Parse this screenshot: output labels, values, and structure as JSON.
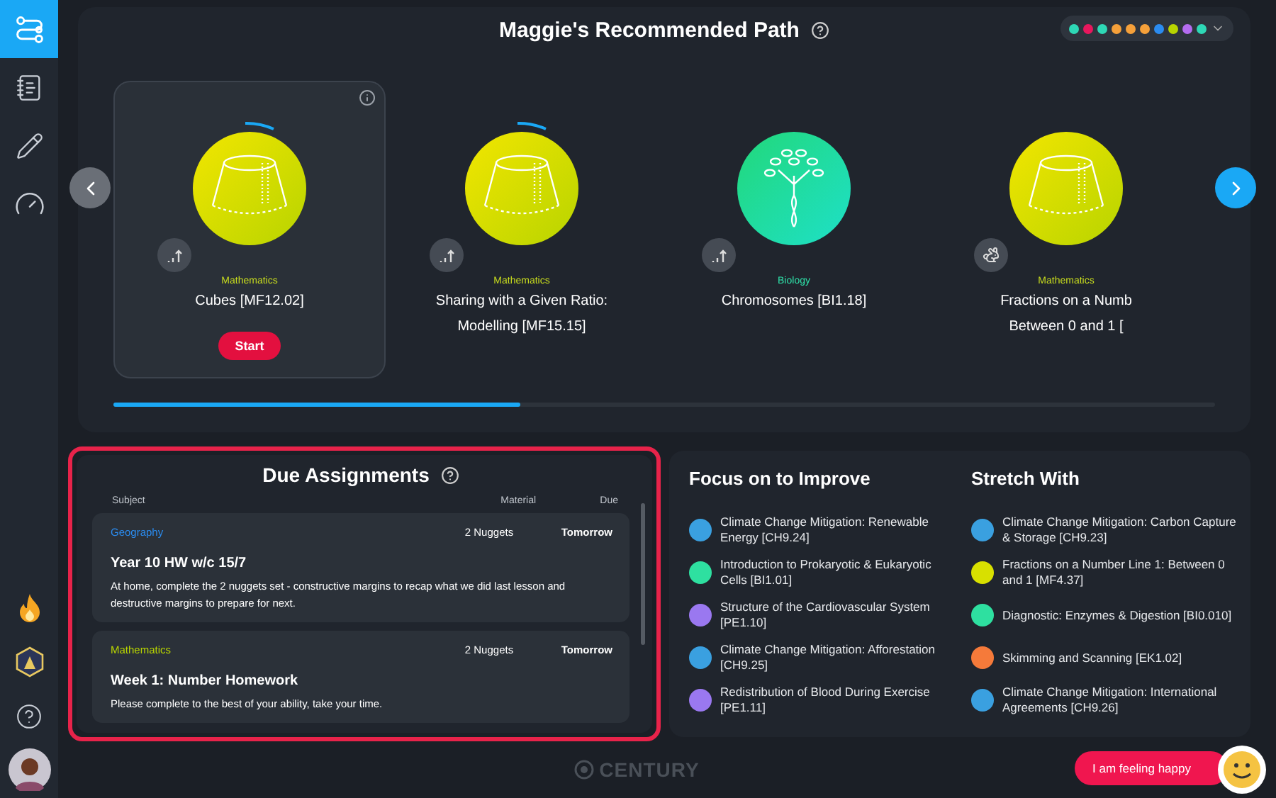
{
  "sidebar": {
    "nav": [
      {
        "kind": "path",
        "selected": true
      },
      {
        "kind": "list",
        "selected": false
      },
      {
        "kind": "pencil",
        "selected": false
      },
      {
        "kind": "gauge",
        "selected": false
      }
    ],
    "bottom": [
      {
        "kind": "flame"
      },
      {
        "kind": "badge"
      },
      {
        "kind": "help"
      },
      {
        "kind": "avatar"
      }
    ]
  },
  "path": {
    "title": "Maggie's Recommended Path",
    "filter_dots": [
      {
        "color": "#2ed8b6"
      },
      {
        "color": "#e8175d"
      },
      {
        "color": "#2ed8b6"
      },
      {
        "color": "#f5a03a"
      },
      {
        "color": "#f5a03a"
      },
      {
        "color": "#f5a03a"
      },
      {
        "color": "#2b8cf0"
      },
      {
        "color": "#b8d400"
      },
      {
        "color": "#b46cf0"
      },
      {
        "color": "#2ed8b6"
      }
    ],
    "cards": [
      {
        "subject": "Mathematics",
        "color": "#c8dc1e",
        "thumbnail": {
          "kind": "cone"
        },
        "badge": {
          "kind": "graph"
        },
        "title_lines": [
          "Cubes [MF12.02]"
        ],
        "started": true,
        "selected": true,
        "action": "Start"
      },
      {
        "subject": "Mathematics",
        "color": "#c8dc1e",
        "thumbnail": {
          "kind": "cone"
        },
        "badge": {
          "kind": "graph"
        },
        "title_lines": [
          "Sharing with a Given Ratio:",
          "Modelling [MF15.15]"
        ],
        "started": true,
        "selected": false
      },
      {
        "subject": "Biology",
        "color": "#2ee0a8",
        "thumbnail": {
          "kind": "tree"
        },
        "badge": {
          "kind": "graph"
        },
        "title_lines": [
          "Chromosomes [BI1.18]"
        ],
        "started": false,
        "selected": false
      },
      {
        "subject": "Mathematics",
        "color": "#c8dc1e",
        "thumbnail": {
          "kind": "cone"
        },
        "badge": {
          "kind": "rabbit"
        },
        "title_lines": [
          "Fractions on a Numb",
          "Between 0 and 1 ["
        ],
        "started": false,
        "selected": false
      }
    ]
  },
  "assignments": {
    "title": "Due Assignments",
    "columns": [
      "Subject",
      "Material",
      "Due"
    ],
    "items": [
      {
        "subject": "Geography",
        "color": "#2b8cf0",
        "material": "2 Nuggets",
        "due": "Tomorrow",
        "title": "Year 10 HW w/c 15/7",
        "description": "At home, complete the 2 nuggets set - constructive margins to recap what we did last lesson and destructive margins to prepare for next."
      },
      {
        "subject": "Mathematics",
        "color": "#b8d400",
        "material": "2 Nuggets",
        "due": "Tomorrow",
        "title": "Week 1: Number Homework",
        "description": "Please complete to the best of your ability, take your time."
      }
    ]
  },
  "focus": {
    "title": "Focus on to Improve",
    "items": [
      {
        "label": "Climate Change Mitigation: Renewable Energy [CH9.24]",
        "color": "#3aa0e0"
      },
      {
        "label": "Introduction to Prokaryotic & Eukaryotic Cells [BI1.01]",
        "color": "#2ee0a0"
      },
      {
        "label": "Structure of the Cardiovascular System [PE1.10]",
        "color": "#9a78f0"
      },
      {
        "label": "Climate Change Mitigation: Afforestation [CH9.25]",
        "color": "#3aa0e0"
      },
      {
        "label": "Redistribution of Blood During Exercise [PE1.11]",
        "color": "#9a78f0"
      }
    ]
  },
  "stretch": {
    "title": "Stretch With",
    "items": [
      {
        "label": "Climate Change Mitigation: Carbon Capture & Storage [CH9.23]",
        "color": "#3aa0e0"
      },
      {
        "label": "Fractions on a Number Line 1: Between 0 and 1 [MF4.37]",
        "color": "#d8e000"
      },
      {
        "label": "Diagnostic: Enzymes & Digestion [BI0.010]",
        "color": "#2ee0a0"
      },
      {
        "label": "Skimming and Scanning [EK1.02]",
        "color": "#f57a3a"
      },
      {
        "label": "Climate Change Mitigation: International Agreements [CH9.26]",
        "color": "#3aa0e0"
      }
    ]
  },
  "footer": {
    "logo": "CENTURY",
    "mood_button": "I am feeling happy"
  }
}
